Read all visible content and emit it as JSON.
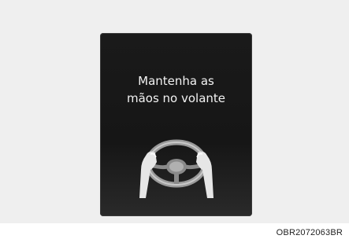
{
  "display": {
    "message_line1": "Mantenha as",
    "message_line2": "mãos no volante",
    "icon": "hands-on-steering-wheel-icon"
  },
  "figure": {
    "code": "OBR2072063BR"
  },
  "colors": {
    "panel_background": "#1a1a1a",
    "text": "#f2f2f2",
    "page_background": "#efefef"
  }
}
